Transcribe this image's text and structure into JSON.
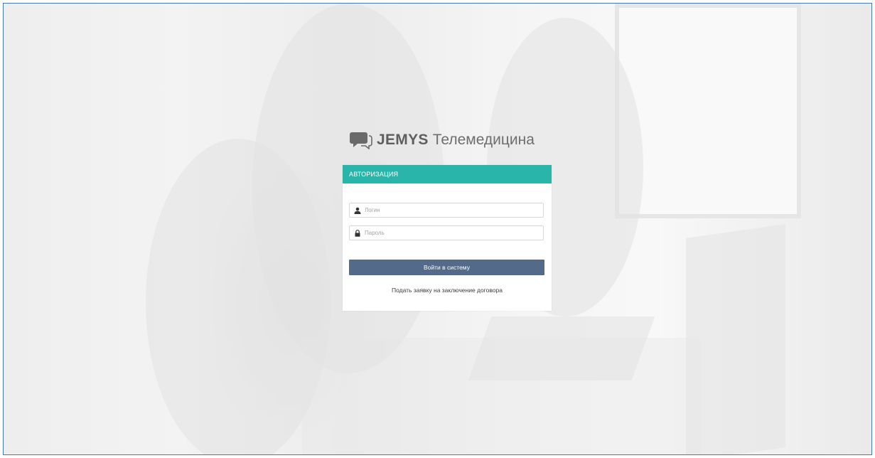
{
  "brand": {
    "name": "JEMYS",
    "product": "Телемедицина",
    "icon": "chat-bubbles-icon"
  },
  "auth": {
    "header": "АВТОРИЗАЦИЯ",
    "login": {
      "placeholder": "Логин",
      "value": "",
      "icon": "user-icon"
    },
    "password": {
      "placeholder": "Пароль",
      "value": "",
      "icon": "lock-icon"
    },
    "submit_label": "Войти в систему",
    "request_link": "Подать заявку на заключение договора"
  },
  "colors": {
    "header_teal": "#2ab5ab",
    "button_blue": "#536a8a",
    "frame_border": "#4a78b5"
  }
}
